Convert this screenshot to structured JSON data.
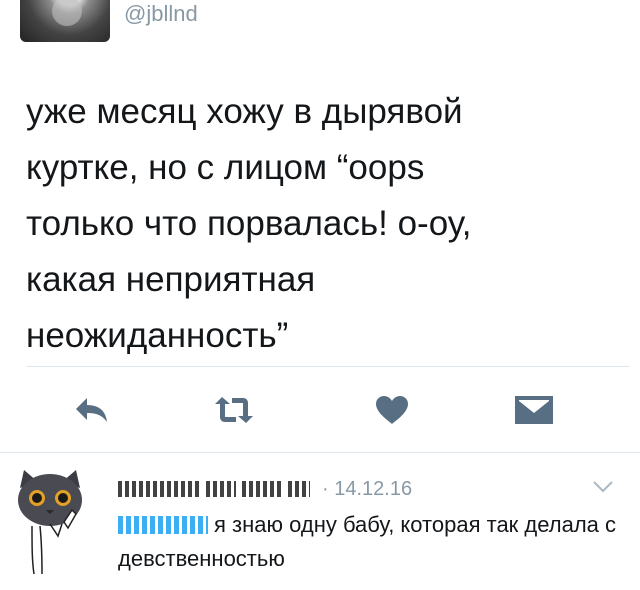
{
  "tweet": {
    "handle": "@jbllnd",
    "text": "уже месяц хожу в дырявой\nкуртке, но с лицом “oops\nтолько что порвалась! о-оу,\nкакая неприятная\nнеожиданность”"
  },
  "actions": [
    {
      "name": "reply-icon"
    },
    {
      "name": "retweet-icon"
    },
    {
      "name": "like-icon"
    },
    {
      "name": "message-icon"
    }
  ],
  "reply": {
    "date": "· 14.12.16",
    "text": "я знаю одну бабу, которая так делала с девственностью"
  },
  "colors": {
    "icon": "#586e83",
    "muted": "#8899a6",
    "text": "#14171a",
    "divider": "#e1e8ed"
  }
}
